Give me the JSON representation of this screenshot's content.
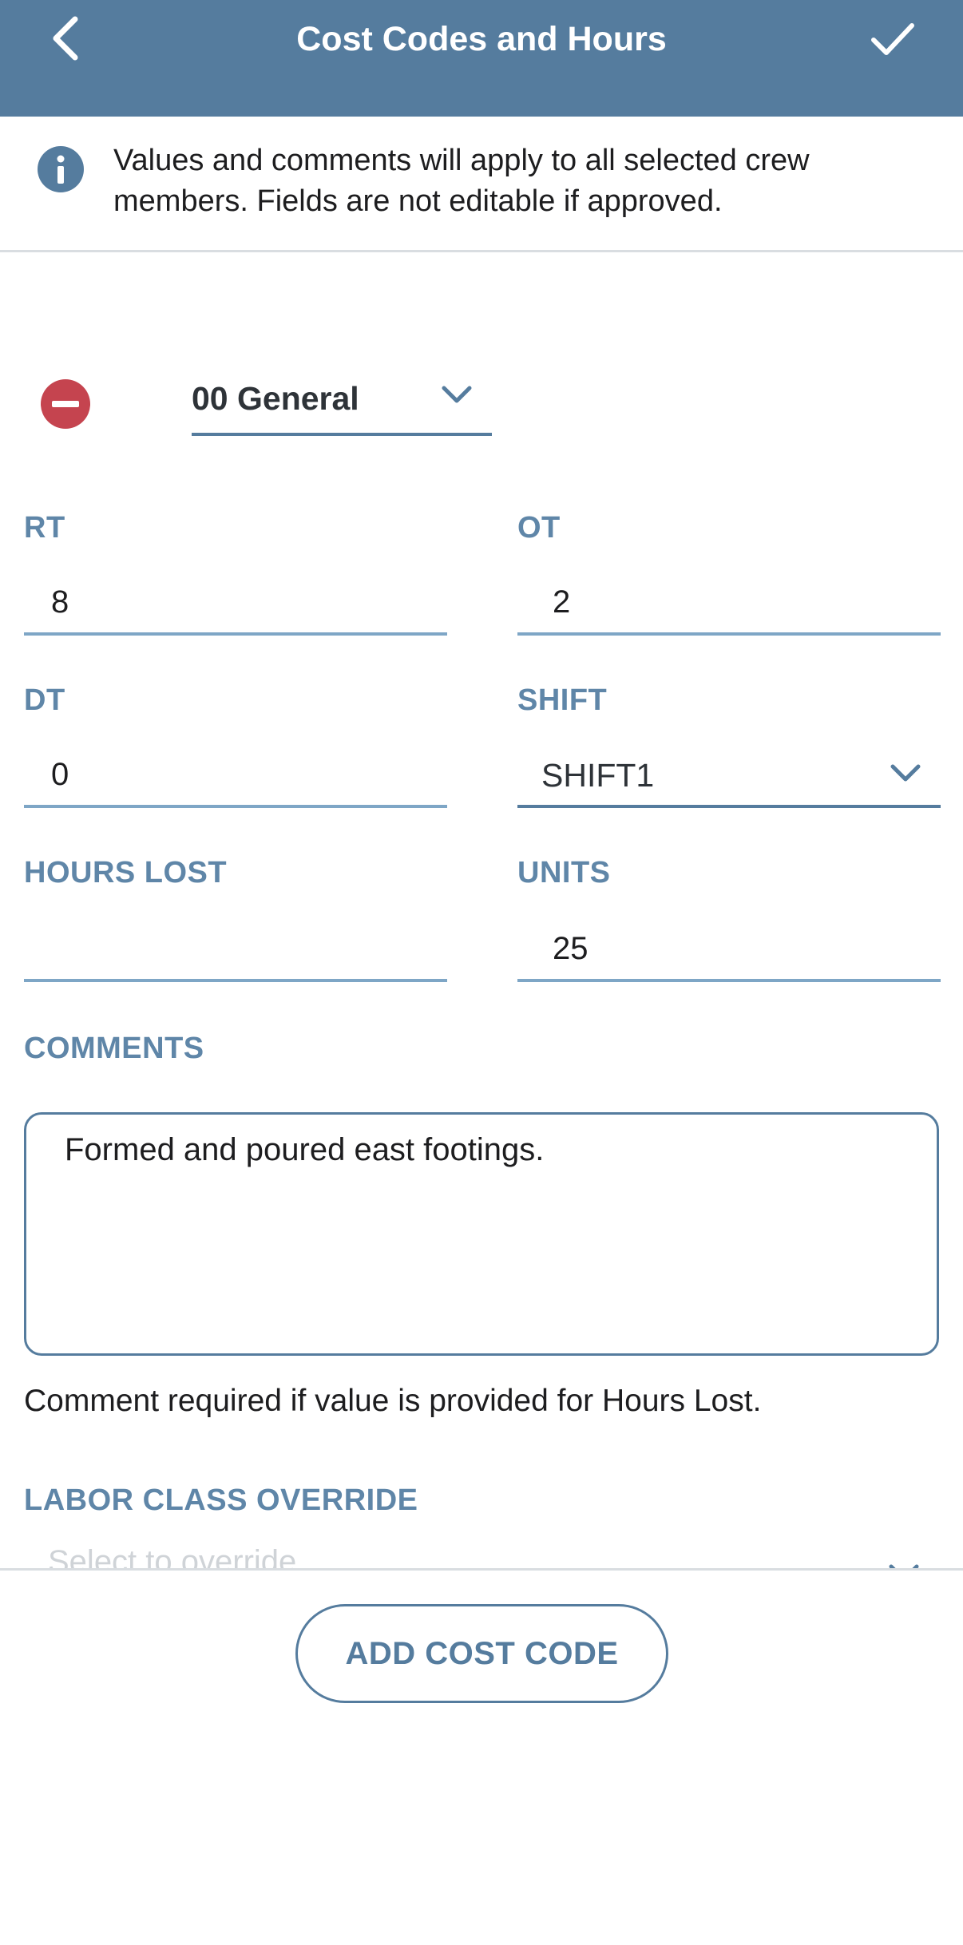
{
  "header": {
    "title": "Cost Codes and Hours",
    "back_icon": "chevron-left-icon",
    "done_icon": "checkmark-icon",
    "background_color": "#557c9e"
  },
  "info": {
    "icon": "info-icon",
    "text": "Values and comments will apply to all selected crew members. Fields are not editable if approved."
  },
  "cost_code": {
    "remove_icon": "minus-circle-icon",
    "remove_color": "#c5444f",
    "selected": "00 General"
  },
  "fields": {
    "rt": {
      "label": "RT",
      "value": "8"
    },
    "ot": {
      "label": "OT",
      "value": "2"
    },
    "dt": {
      "label": "DT",
      "value": "0"
    },
    "shift": {
      "label": "SHIFT",
      "value": "SHIFT1"
    },
    "hours_lost": {
      "label": "HOURS LOST",
      "value": ""
    },
    "units": {
      "label": "UNITS",
      "value": "25"
    }
  },
  "comments": {
    "label": "COMMENTS",
    "value": "Formed and poured east footings.",
    "helper": "Comment required if value is provided for Hours Lost."
  },
  "labor_class_override": {
    "label": "LABOR CLASS OVERRIDE",
    "placeholder": "Select to override"
  },
  "actions": {
    "add_cost_code": "ADD COST CODE"
  }
}
